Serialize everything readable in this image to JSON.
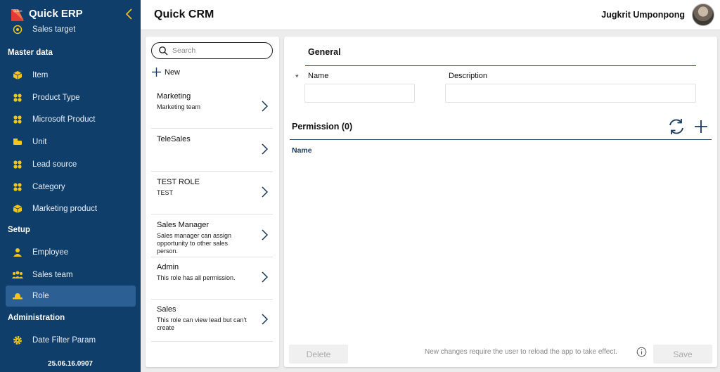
{
  "sidebar": {
    "brand_title": "Quick ERP",
    "partial_item": "Sales target",
    "sections": {
      "master": "Master data",
      "setup": "Setup",
      "admin": "Administration"
    },
    "master_items": [
      {
        "label": "Item",
        "icon": "cube-icon"
      },
      {
        "label": "Product Type",
        "icon": "grid-icon"
      },
      {
        "label": "Microsoft Product",
        "icon": "grid-icon"
      },
      {
        "label": "Unit",
        "icon": "unit-icon"
      },
      {
        "label": "Lead source",
        "icon": "grid-icon"
      },
      {
        "label": "Category",
        "icon": "grid-icon"
      },
      {
        "label": "Marketing product",
        "icon": "cube-icon"
      }
    ],
    "setup_items": [
      {
        "label": "Employee",
        "icon": "person-icon"
      },
      {
        "label": "Sales team",
        "icon": "group-icon"
      },
      {
        "label": "Role",
        "icon": "hat-icon",
        "active": true
      }
    ],
    "admin_items": [
      {
        "label": "Date Filter Param",
        "icon": "gear-icon"
      }
    ],
    "version": "25.06.16.0907",
    "accent_color": "#f5c518",
    "bg_color": "#0f3e6a"
  },
  "header": {
    "title": "Quick CRM",
    "user_name": "Jugkrit Umponpong"
  },
  "roles_list": {
    "search_placeholder": "Search",
    "new_label": "New",
    "items": [
      {
        "name": "Marketing",
        "description": "Marketing team"
      },
      {
        "name": "TeleSales",
        "description": ""
      },
      {
        "name": "TEST ROLE",
        "description": "TEST"
      },
      {
        "name": "Sales Manager",
        "description": "Sales manager can assign opportunity to other sales person."
      },
      {
        "name": "Admin",
        "description": "This role has all permission."
      },
      {
        "name": "Sales",
        "description": "This role can view lead but can't create"
      }
    ]
  },
  "detail": {
    "general_tab": "General",
    "required_mark": "*",
    "name_label": "Name",
    "name_value": "",
    "description_label": "Description",
    "description_value": "",
    "permission_title": "Permission (0)",
    "column_name": "Name",
    "delete_label": "Delete",
    "save_label": "Save",
    "notice": "New changes require the user to reload the app to take effect."
  }
}
